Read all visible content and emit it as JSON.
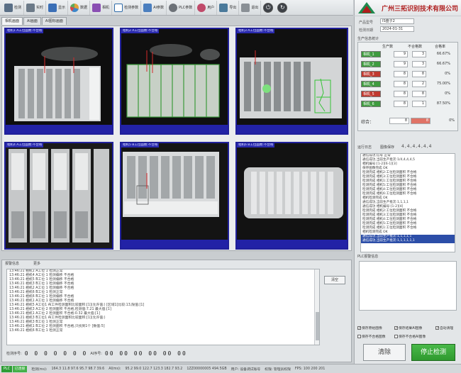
{
  "toolbar": {
    "items": [
      {
        "label": "检测",
        "icon": "detect-icon",
        "color": "#5a6f86"
      },
      {
        "label": "实时",
        "icon": "realtime-icon",
        "color": "#6c7a88"
      },
      {
        "label": "显示",
        "icon": "display-icon",
        "color": "#3b6fb6"
      },
      {
        "label": "数据",
        "icon": "data-pie-icon",
        "color": "#e0a23a"
      },
      {
        "label": "相机",
        "icon": "camera-icon",
        "color": "#8a4fb3"
      },
      {
        "label": "检测参数",
        "icon": "check-params-icon",
        "color": "#2d6aa8"
      },
      {
        "label": "AI参数",
        "icon": "ai-params-icon",
        "color": "#4b7fbf"
      },
      {
        "label": "PLC参数",
        "icon": "gear-icon",
        "color": "#6d7278"
      },
      {
        "label": "用户",
        "icon": "users-icon",
        "color": "#c04a6a"
      },
      {
        "label": "导出",
        "icon": "export-icon",
        "color": "#4a7a9b"
      },
      {
        "label": "退出",
        "icon": "exit-icon",
        "color": "#8a9096"
      }
    ],
    "power_glyph": "⏻",
    "refresh_glyph": "↻"
  },
  "header": {
    "company": "广州三拓识别技术有限公司"
  },
  "tabs": [
    {
      "label": "相机画面",
      "active": true
    },
    {
      "label": "AI画面",
      "active": false
    },
    {
      "label": "AI图标画面",
      "active": false
    }
  ],
  "cameras": [
    {
      "title": "相机1 A工位面数:不合格"
    },
    {
      "title": "相机2 A工位面数:不合格"
    },
    {
      "title": "相机3 A工位面数:不合格"
    },
    {
      "title": "相机4 A工位面数:不合格"
    },
    {
      "title": "相机5 B工位面数:不合格"
    },
    {
      "title": "相机6 B工位面数:不合格"
    }
  ],
  "panel": {
    "product_label": "产品型号",
    "product_value": "IS盘子2",
    "date_label": "检测日期",
    "date_value": "2024-01-31",
    "stats_title": "生产信息统计",
    "col_produce": "生产数",
    "col_fail": "不合格数",
    "col_rate": "合格率",
    "rows": [
      {
        "name": "相机_1",
        "produce": "9",
        "fail": "3",
        "rate": "66.67%",
        "color": "#3f9b3f"
      },
      {
        "name": "相机_2",
        "produce": "9",
        "fail": "3",
        "rate": "66.67%",
        "color": "#3f9b3f"
      },
      {
        "name": "相机_3",
        "produce": "8",
        "fail": "8",
        "rate": "0%",
        "color": "#c03a30"
      },
      {
        "name": "相机_4",
        "produce": "8",
        "fail": "2",
        "rate": "75.00%",
        "color": "#3f9b3f"
      },
      {
        "name": "相机_5",
        "produce": "8",
        "fail": "8",
        "rate": "0%",
        "color": "#c03a30"
      },
      {
        "name": "相机_6",
        "produce": "8",
        "fail": "1",
        "rate": "87.50%",
        "color": "#3f9b3f"
      }
    ],
    "summary_label": "综合：",
    "summary_produce": "8",
    "summary_fail": "8",
    "summary_rate": "0%",
    "run_log_label": "运行日志",
    "status_label": "图像保存",
    "status_value": "4,4,4,4,4,4",
    "log_lines": [
      "通信成功,信号 正常",
      "通信成功,当前生产批次:1/4,4,4,4,5",
      "相机编号:[1-2][6-1][3]",
      "保存图像完成 OK",
      "检测完成 相机2:工位检测面积 不合格",
      "检测完成 相机3:工位检测面积 不合格",
      "检测完成 相机1:工位检测面积 不合格",
      "检测完成 相机5:工位检测面积 不合格",
      "检测完成 相机4:工位检测面积 不合格",
      "检测完成 相机6:工位检测面积 不合格",
      "相机检测完成 OK",
      "通信成功,当前生产批次:1,1,1,1",
      "通信成功 相机编号:[1-2][4]",
      "检测完成 相机2:工位检测面积 不合格",
      "检测完成 相机3:工位检测面积 不合格",
      "检测完成 相机4:工位检测面积 不合格",
      "检测完成 相机5:工位检测面积 不合格",
      "检测完成 相机1:工位检测面积 不合格",
      "相机检测完成 OK",
      "通信成功,当前生产批次:1,1,1,1,1",
      "通信成功,当前生产批次:1,1,1,1,1,1"
    ],
    "ai_label": "PLC报警信息",
    "options": [
      "保存原始图像",
      "保存结果AI图像",
      "保存不合格图像",
      "保存不合格AI图像",
      "自动清理"
    ],
    "clear_label": "清除",
    "stop_label": "停止检测"
  },
  "bottom": {
    "title": "报警信息",
    "tab2": "更多",
    "lines": [
      "13:46:21 相机1 A工位 1 检测正常",
      "13:46:21 相机4 A工位 1 检测偏移 不合格",
      "13:46:21 相机5 B工位 1 检测偏移 不合格",
      "13:46:21 相机3 B工位 1 检测偏移 不合格",
      "13:46:21 相机2 A工位 1 检测偏移 不合格",
      "13:46:21 相机6 B工位 1 检测正常",
      "13:46:21 相机6 B工位 1 检测偏移 不合格",
      "13:46:21 相机1 A工位 1 检测偏移 不合格",
      "13:46:21 相机5 A工位1 AI工件检测面积比较面积:[1](允许值:) [区域1]比较:13,限值:[1]",
      "13:46:21 相机3 A工位 2 检测面积 不合格,检测值:7.21 最大值:[1]",
      "13:46:21 相机1 A工位 2 检测面积 不合格:0.32 最大值:[1]",
      "13:46:21 相机3 B工位1 AI工件检测面积比较面积:[1](允许值:)",
      "13:46:21 相机3 B工位 1 检测正常",
      "13:46:21 相机1 B工位 2 检测面积 不合格,只找到1个 [数值:5]",
      "13:46:21 相机6 B工位 1 检测正常"
    ],
    "clear_label": "清空",
    "counter_label": "检测序号:",
    "counter_digits": "0 0 0 0 0 0 0",
    "ai_counter_label": "AI序号:",
    "ai_counter_digits": "00 00 00 00 00 00"
  },
  "status": {
    "plc": "PLC",
    "mode": "已连接",
    "items": [
      "检测(ms):",
      "164.3  11.8  97.6  95.7  98.7  39.6",
      "AI(ms):",
      "95.2  99.0  122.7  123.3  182.7  93.2",
      "1ZZ00000005  494.5GB",
      "用户: 设备调试账号",
      "权限: 管理员权限",
      "FPS: 100  200  201"
    ]
  }
}
